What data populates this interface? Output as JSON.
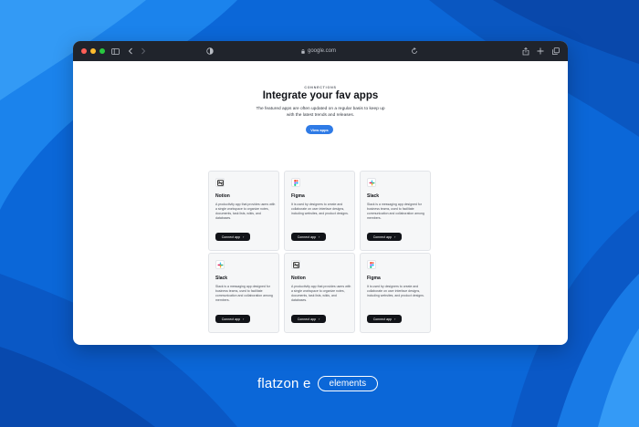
{
  "colors": {
    "background": "#0b67d8",
    "toolbar": "#20242c",
    "accent": "#2f7be6",
    "button_dark": "#111318",
    "traffic_red": "#ff5f57",
    "traffic_yellow": "#febc2e",
    "traffic_green": "#28c840"
  },
  "browser": {
    "url": "google.com",
    "icons": [
      "sidebar-icon",
      "back-icon",
      "forward-icon",
      "shield-icon",
      "lock-icon",
      "reload-icon",
      "share-icon",
      "new-tab-icon",
      "tabs-overview-icon"
    ]
  },
  "page": {
    "eyebrow": "CONNECTIONS",
    "title": "Integrate your fav apps",
    "description": "The featured apps are often updated on a regular basis to keep up with the latest trends and releases.",
    "view_button": "View apps"
  },
  "cards": [
    {
      "name": "Notion",
      "icon": "notion-icon",
      "description": "A productivity app that provides users with a single workspace to organize notes, documents, task lists, wikis, and databases.",
      "button": "Connect app"
    },
    {
      "name": "Figma",
      "icon": "figma-icon",
      "description": "It is used by designers to create and collaborate on user interface designs, including websites, and product designs.",
      "button": "Connect app"
    },
    {
      "name": "Slack",
      "icon": "slack-icon",
      "description": "Slack is a messaging app designed for business teams, used to facilitate communication and collaboration among members.",
      "button": "Connect app"
    },
    {
      "name": "Slack",
      "icon": "slack-icon",
      "description": "Slack is a messaging app designed for business teams, used to facilitate communication and collaboration among members.",
      "button": "Connect app"
    },
    {
      "name": "Notion",
      "icon": "notion-icon",
      "description": "A productivity app that provides users with a single workspace to organize notes, documents, task lists, wikis, and databases.",
      "button": "Connect app"
    },
    {
      "name": "Figma",
      "icon": "figma-icon",
      "description": "It is used by designers to create and collaborate on user interface designs, including websites, and product designs.",
      "button": "Connect app"
    }
  ],
  "branding": {
    "name": "flatzon e",
    "tag": "elements"
  }
}
